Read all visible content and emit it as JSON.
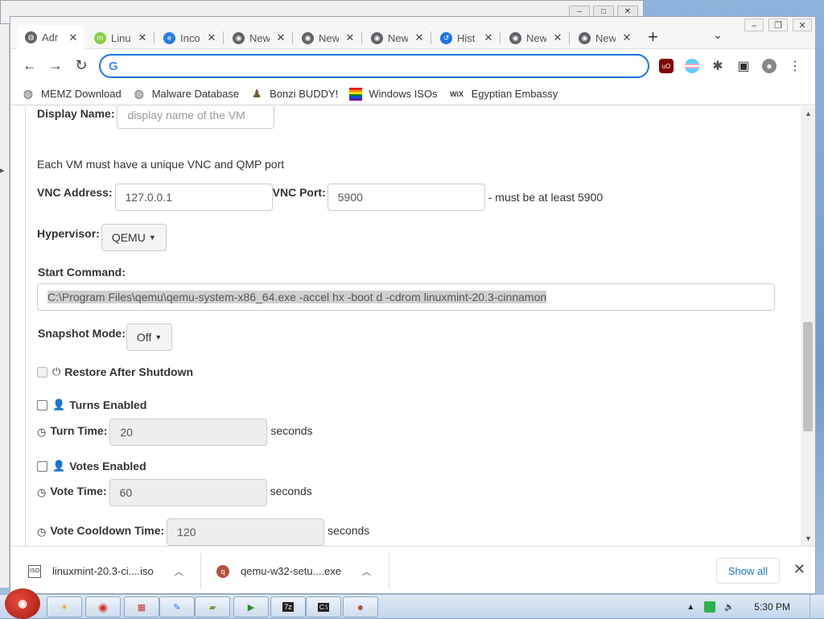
{
  "browser": {
    "tabs": [
      {
        "label": "Adr",
        "icon": "globe-icon",
        "active": true
      },
      {
        "label": "Linu",
        "icon": "mint-icon",
        "active": false
      },
      {
        "label": "Inco",
        "icon": "edge-icon",
        "active": false
      },
      {
        "label": "New",
        "icon": "chrome-icon",
        "active": false
      },
      {
        "label": "New",
        "icon": "chrome-icon",
        "active": false
      },
      {
        "label": "New",
        "icon": "chrome-icon",
        "active": false
      },
      {
        "label": "Hist",
        "icon": "history-icon",
        "active": false
      },
      {
        "label": "New",
        "icon": "chrome-icon",
        "active": false
      },
      {
        "label": "New",
        "icon": "chrome-icon",
        "active": false
      }
    ],
    "omnibox": {
      "value": "",
      "placeholder": ""
    },
    "bookmarks": [
      {
        "label": "MEMZ Download",
        "icon": "globe-icon"
      },
      {
        "label": "Malware Database",
        "icon": "globe-icon"
      },
      {
        "label": "Bonzi BUDDY!",
        "icon": "bonzi-icon"
      },
      {
        "label": "Windows ISOs",
        "icon": "rainbow-flag-icon"
      },
      {
        "label": "Egyptian Embassy",
        "icon": "wix-icon"
      }
    ]
  },
  "form": {
    "display_name_label": "Display Name:",
    "display_name_placeholder": "display name of the VM",
    "unique_port_note": "Each VM must have a unique VNC and QMP port",
    "vnc_address_label": "VNC Address:",
    "vnc_address_value": "127.0.0.1",
    "vnc_port_label": "VNC Port:",
    "vnc_port_value": "5900",
    "vnc_port_hint": "- must be at least 5900",
    "hypervisor_label": "Hypervisor:",
    "hypervisor_value": "QEMU",
    "start_command_label": "Start Command:",
    "start_command_value": "C:\\Program Files\\qemu\\qemu-system-x86_64.exe -accel hx -boot d -cdrom linuxmint-20.3-cinnamon",
    "snapshot_label": "Snapshot Mode:",
    "snapshot_value": "Off",
    "restore_label": "Restore After Shutdown",
    "turns_label": "Turns Enabled",
    "turn_time_label": "Turn Time:",
    "turn_time_value": "20",
    "seconds": "seconds",
    "votes_label": "Votes Enabled",
    "vote_time_label": "Vote Time:",
    "vote_time_value": "60",
    "vote_cooldown_label": "Vote Cooldown Time:",
    "vote_cooldown_value": "120"
  },
  "downloads": {
    "items": [
      {
        "name": "linuxmint-20.3-ci....iso"
      },
      {
        "name": "qemu-w32-setu....exe"
      }
    ],
    "show_all": "Show all"
  },
  "taskbar": {
    "clock": "5:30 PM",
    "start_label": "Start"
  },
  "colors": {
    "accent": "#1a73e8",
    "taskbar": "#c4d6ec"
  }
}
